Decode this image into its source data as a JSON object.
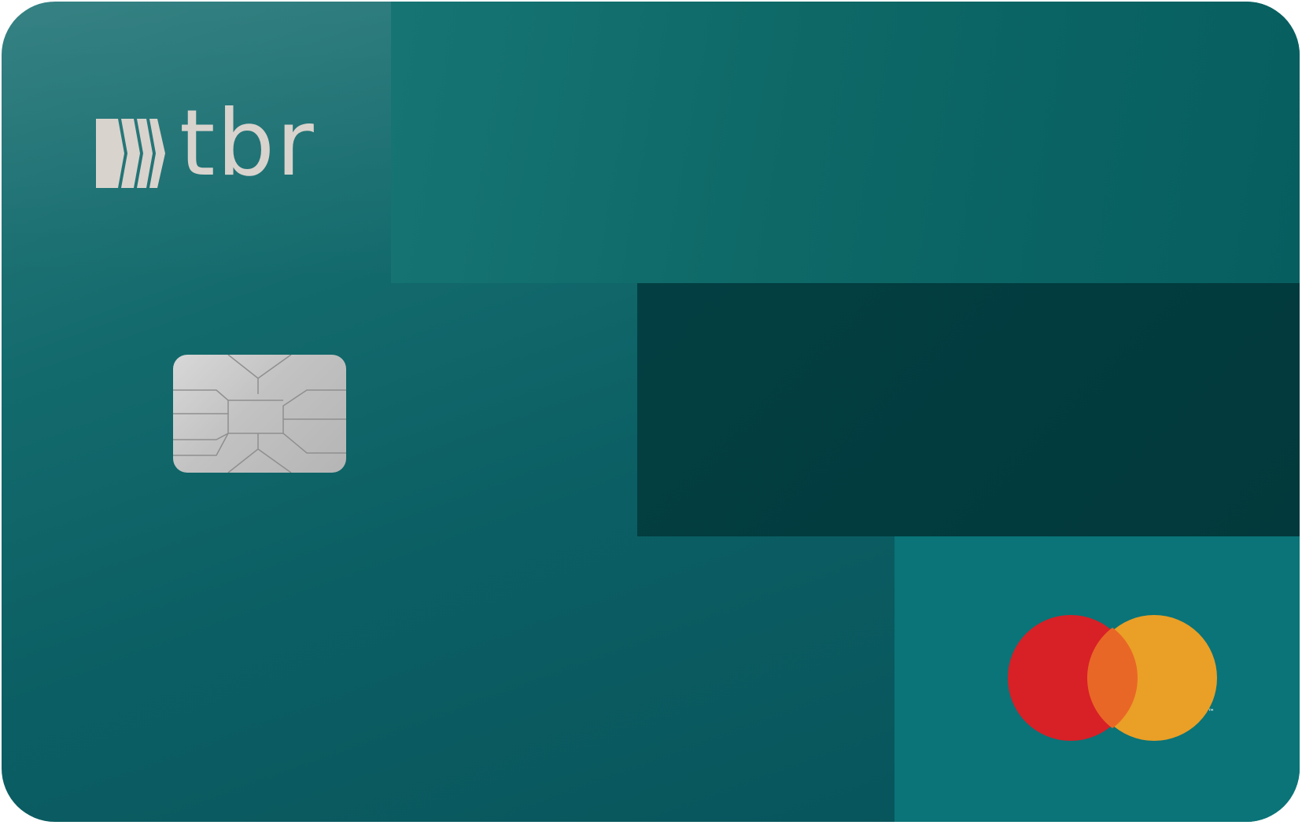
{
  "card": {
    "brand_name": "tbr",
    "network": "mastercard",
    "trademark": "™"
  },
  "icons": {
    "logo_mark": "tbr-chevron-logo-icon",
    "chip": "emv-chip-icon",
    "network_logo": "mastercard-logo-icon"
  },
  "colors": {
    "card_base": "#0b5f64",
    "panel_top": "#0d6866",
    "panel_mid": "#033f42",
    "panel_bottom": "#0a7478",
    "logo_text": "#d9d3cd",
    "mc_red": "#d82027",
    "mc_orange": "#e96726",
    "mc_yellow": "#ea9f27"
  }
}
